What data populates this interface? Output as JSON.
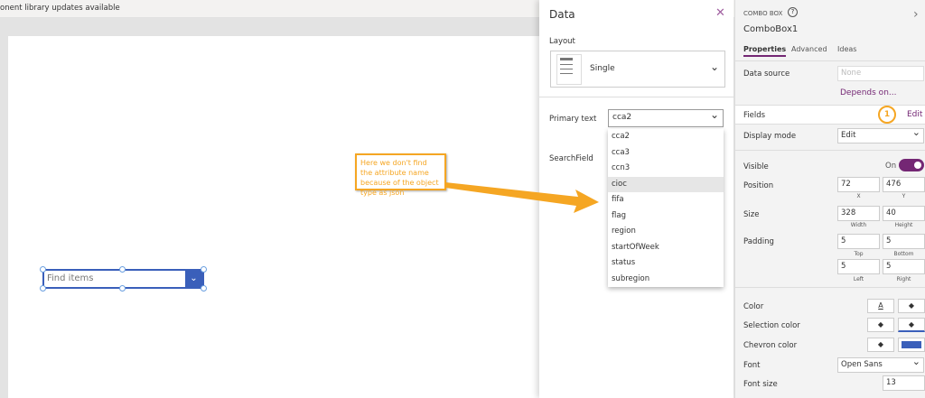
{
  "topbar": {
    "notice": "onent library updates available"
  },
  "canvas": {
    "combo_placeholder": "Find items",
    "callout": "Here we don't find the attribute name because of the object type as json"
  },
  "data_panel": {
    "title": "Data",
    "close_icon": "close-icon",
    "layout_label": "Layout",
    "layout_value": "Single",
    "primary_label": "Primary text",
    "primary_value": "cca2",
    "search_label": "SearchField",
    "options": [
      "cca2",
      "cca3",
      "ccn3",
      "cioc",
      "fifa",
      "flag",
      "region",
      "startOfWeek",
      "status",
      "subregion"
    ],
    "highlighted": "cioc"
  },
  "props": {
    "type": "COMBO BOX",
    "name": "ComboBox1",
    "tabs": [
      "Properties",
      "Advanced",
      "Ideas"
    ],
    "data_source_label": "Data source",
    "data_source_value": "None",
    "depends": "Depends on...",
    "fields_label": "Fields",
    "badge": "1",
    "edit": "Edit",
    "display_mode_label": "Display mode",
    "display_mode_value": "Edit",
    "visible_label": "Visible",
    "visible_value": "On",
    "visible_on": true,
    "position_label": "Position",
    "x": "72",
    "y": "476",
    "x_label": "X",
    "y_label": "Y",
    "size_label": "Size",
    "width": "328",
    "height": "40",
    "width_label": "Width",
    "height_label": "Height",
    "padding_label": "Padding",
    "top": "5",
    "bottom": "5",
    "left": "5",
    "right": "5",
    "top_label": "Top",
    "bottom_label": "Bottom",
    "left_label": "Left",
    "right_label": "Right",
    "color_label": "Color",
    "selection_color_label": "Selection color",
    "chevron_color_label": "Chevron color",
    "font_label": "Font",
    "font_value": "Open Sans",
    "font_size_label": "Font size",
    "font_size_value": "13"
  },
  "colors": {
    "accent": "#742774",
    "chevron": "#3a5fba",
    "callout": "#f5a623"
  }
}
